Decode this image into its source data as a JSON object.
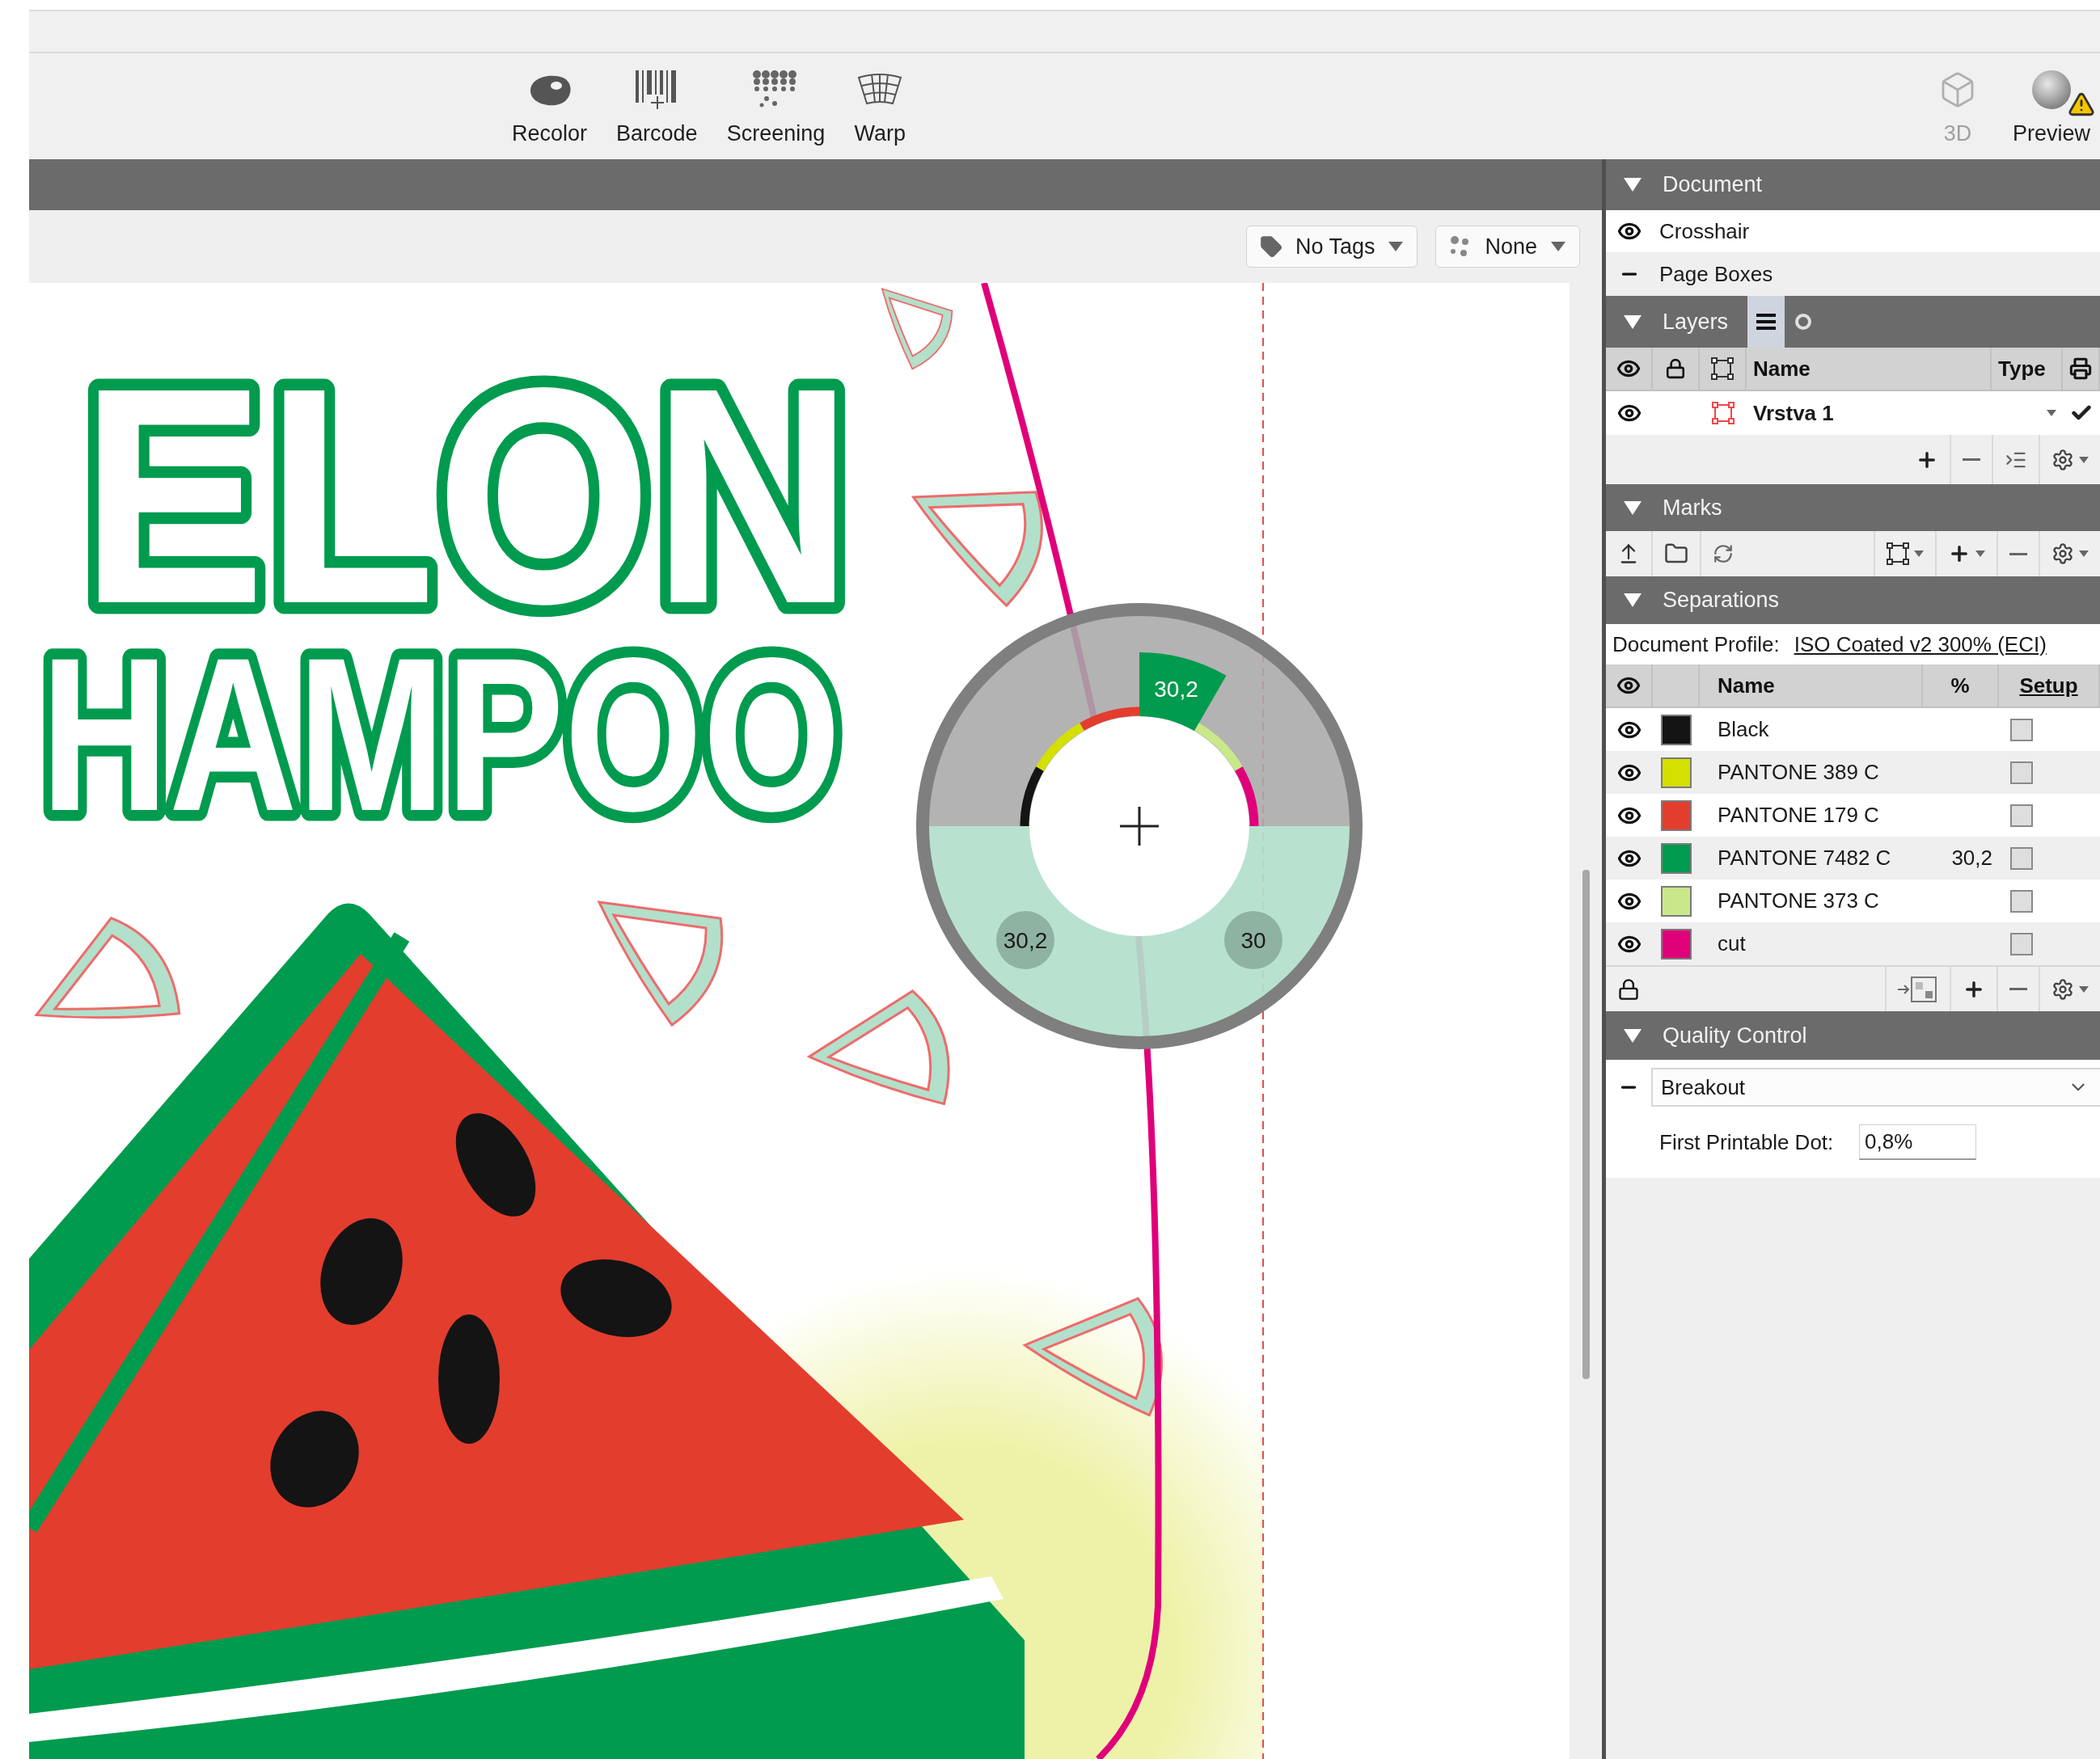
{
  "toolbar": {
    "tools": [
      {
        "kind": "recolor",
        "label": "Recolor",
        "disabled": false
      },
      {
        "kind": "barcode",
        "label": "Barcode",
        "disabled": false
      },
      {
        "kind": "screening",
        "label": "Screening",
        "disabled": false
      },
      {
        "kind": "warp",
        "label": "Warp",
        "disabled": false
      }
    ],
    "right_tools": [
      {
        "kind": "cube",
        "label": "3D",
        "disabled": true,
        "warning": false
      },
      {
        "kind": "preview",
        "label": "Preview",
        "disabled": false,
        "warning": true
      }
    ]
  },
  "filter_bar": {
    "tags": "No Tags",
    "grouping": "None"
  },
  "artwork": {
    "lettering": [
      "ELON",
      "HAMPOO"
    ]
  },
  "density_ring": {
    "tab_reading": "30,2",
    "left_reading": "30,2",
    "right_reading": "30"
  },
  "panel": {
    "document": {
      "title": "Document",
      "expanded": true,
      "items": [
        {
          "label": "Crosshair",
          "visible": true
        },
        {
          "label": "Page Boxes",
          "visible": false
        }
      ]
    },
    "layers": {
      "title": "Layers",
      "expanded": true,
      "view_tabs": [
        {
          "kind": "list",
          "selected": true
        },
        {
          "kind": "circle",
          "selected": false
        }
      ],
      "columns": [
        "Name",
        "Type"
      ],
      "rows": [
        {
          "name": "Vrstva 1",
          "visible": true,
          "locked": false,
          "printed": true
        }
      ]
    },
    "marks": {
      "title": "Marks",
      "expanded": true
    },
    "separations": {
      "title": "Separations",
      "expanded": true,
      "profile_label": "Document Profile:",
      "profile": "ISO Coated v2 300% (ECI)",
      "columns": [
        "Name",
        "%",
        "Setup"
      ],
      "rows": [
        {
          "name": "Black",
          "color": "#141414",
          "visible": true,
          "checked": false
        },
        {
          "name": "PANTONE 389 C",
          "color": "#d4e000",
          "visible": true,
          "checked": false
        },
        {
          "name": "PANTONE 179 C",
          "color": "#e33d2e",
          "visible": true,
          "checked": false
        },
        {
          "name": "PANTONE 7482 C",
          "color": "#009b4e",
          "percent": "30,2",
          "visible": true,
          "checked": false
        },
        {
          "name": "PANTONE 373 C",
          "color": "#c9e88a",
          "visible": true,
          "checked": false
        },
        {
          "name": "cut",
          "color": "#e0007a",
          "visible": true,
          "checked": false
        }
      ]
    },
    "quality_control": {
      "title": "Quality Control",
      "expanded": true,
      "check": "Breakout",
      "field_label": "First Printable Dot:",
      "field_value": "0,8%"
    }
  }
}
